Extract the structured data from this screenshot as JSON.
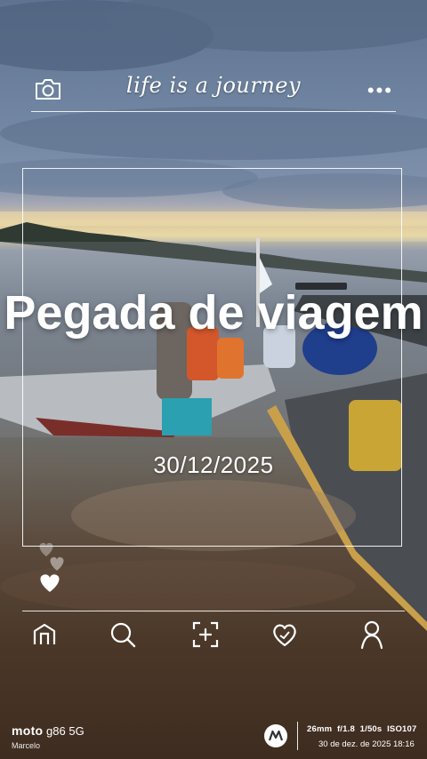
{
  "header": {
    "camera_icon": "camera-icon",
    "tagline": "life is a journey",
    "more_icon": "more-dots-icon"
  },
  "card": {
    "title": "Pegada de viagem",
    "date": "30/12/2025"
  },
  "nav": {
    "items": [
      {
        "icon": "home-icon"
      },
      {
        "icon": "search-icon"
      },
      {
        "icon": "add-photo-icon"
      },
      {
        "icon": "heart-icon"
      },
      {
        "icon": "profile-icon"
      }
    ]
  },
  "watermark": {
    "brand": "moto",
    "model": "g86 5G",
    "owner": "Marcelo",
    "specs": "26mm  f/1.8  1/50s  ISO107",
    "datetime": "30 de dez. de 2025 18:16"
  },
  "colors": {
    "overlay_text": "#ffffff"
  }
}
